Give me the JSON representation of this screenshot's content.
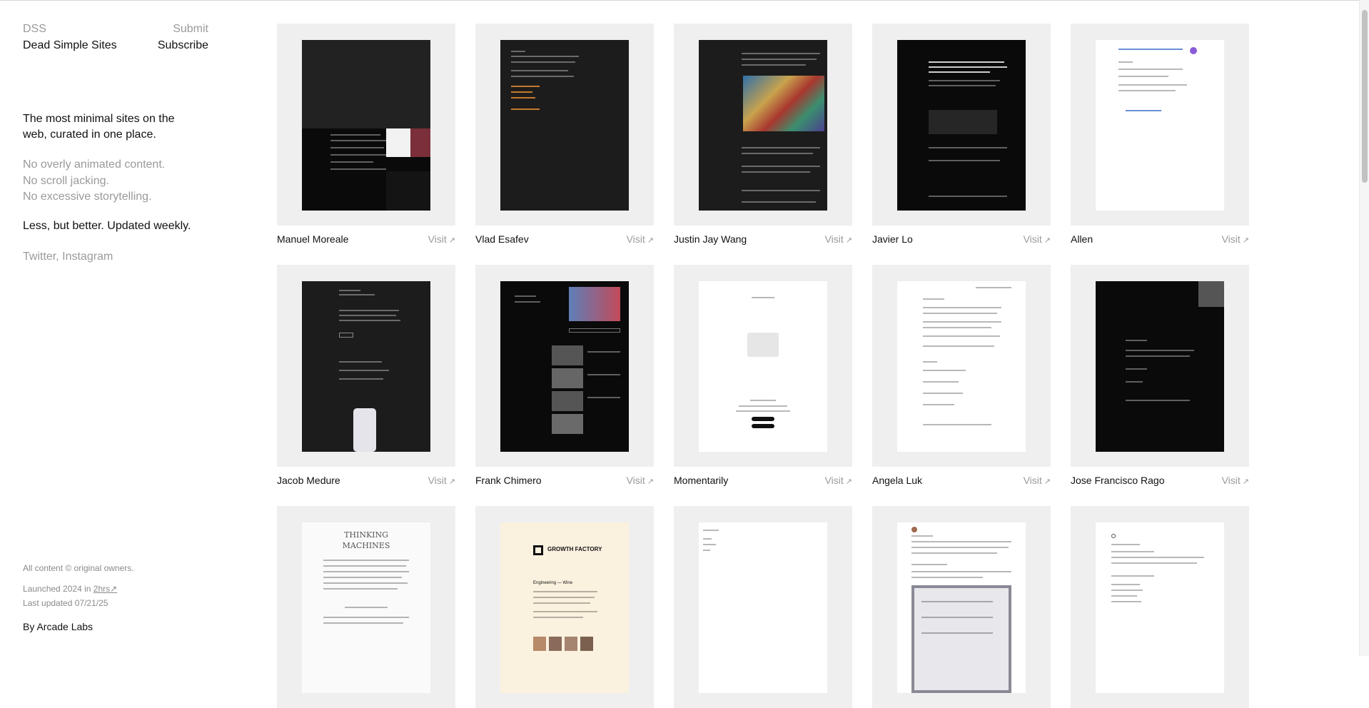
{
  "sidebar": {
    "brand_short": "DSS",
    "brand_name": "Dead Simple Sites",
    "submit_label": "Submit",
    "subscribe_label": "Subscribe",
    "tagline": "The most minimal sites on the web, curated in one place.",
    "nos": [
      "No overly animated content.",
      "No scroll jacking.",
      "No excessive storytelling."
    ],
    "motto": "Less, but better. Updated weekly.",
    "social": {
      "twitter": "Twitter",
      "separator": ", ",
      "instagram": "Instagram"
    }
  },
  "footer": {
    "copyright": "All content © original owners.",
    "launched_prefix": "Launched 2024 in",
    "launched_link": "2hrs",
    "launched_arrow": "↗",
    "updated": "Last updated 07/21/25",
    "by": "By Arcade Labs"
  },
  "card_visit_label": "Visit",
  "card_visit_arrow": "↗",
  "sites": [
    {
      "name": "Manuel Moreale"
    },
    {
      "name": "Vlad Esafev"
    },
    {
      "name": "Justin Jay Wang"
    },
    {
      "name": "Javier Lo"
    },
    {
      "name": "Allen"
    },
    {
      "name": "Jacob Medure"
    },
    {
      "name": "Frank Chimero"
    },
    {
      "name": "Momentarily"
    },
    {
      "name": "Angela Luk"
    },
    {
      "name": "Jose Francisco Rago"
    },
    {
      "name": "Thinking Machines",
      "preview_title": "THINKING MACHINES"
    },
    {
      "name": "Growth Factory",
      "preview_title": "GROWTH FACTORY",
      "preview_heading": "Engineering — Wine"
    },
    {
      "name": ""
    },
    {
      "name": ""
    },
    {
      "name": ""
    }
  ],
  "colors": {
    "thumb_bg": "#efefef",
    "muted_text": "#9a9a9a",
    "primary_text": "#111111",
    "dark_preview": "#1c1c1c",
    "black_preview": "#0a0a0a",
    "cream_preview": "#fbf1df"
  }
}
